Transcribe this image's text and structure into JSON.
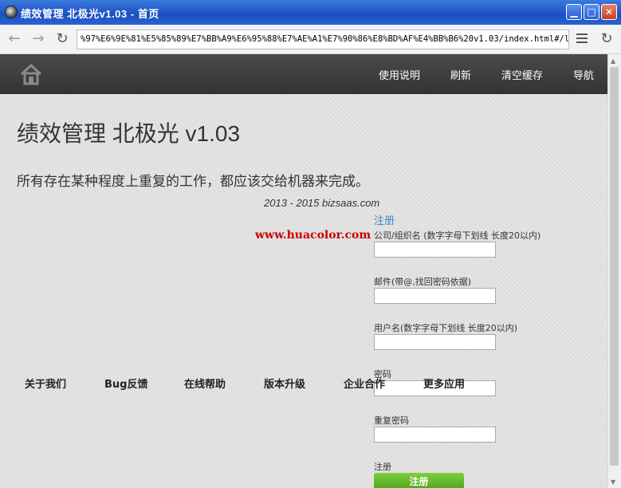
{
  "window": {
    "title": "绩效管理 北极光v1.03 - 首页",
    "minimize": "▁",
    "maximize": "□",
    "close": "✕"
  },
  "browser": {
    "back": "←",
    "forward": "→",
    "reload": "↻",
    "url": "%97%E6%9E%81%E5%85%89%E7%BB%A9%E6%95%88%E7%AE%A1%E7%90%86%E8%BD%AF%E4%BB%B6%20v1.03/index.html#/login"
  },
  "site_nav": {
    "home_icon": "home-icon",
    "links": [
      "使用说明",
      "刷新",
      "清空缓存",
      "导航"
    ]
  },
  "hero": {
    "title": "绩效管理 北极光 v1.03",
    "subtitle": "所有存在某种程度上重复的工作，都应该交给机器来完成。",
    "copyright": "2013 - 2015 bizsaas.com"
  },
  "watermark": "www.huacolor.com",
  "register": {
    "heading_link": "注册",
    "fields": [
      {
        "label": "公司/组织名 (数字字母下划线 长度20以内)",
        "value": ""
      },
      {
        "label": "邮件(带@,找回密码依据)",
        "value": ""
      },
      {
        "label": "用户名(数字字母下划线 长度20以内)",
        "value": ""
      },
      {
        "label": "密码",
        "value": ""
      },
      {
        "label": "重复密码",
        "value": ""
      }
    ],
    "submit_caption": "注册",
    "submit_button": "注册"
  },
  "footer": {
    "links": [
      "关于我们",
      "Bug反馈",
      "在线帮助",
      "版本升级",
      "企业合作",
      "更多应用"
    ]
  },
  "colors": {
    "nav_bg": "#3a3a3a",
    "link_blue": "#3a87c8",
    "watermark_red": "#cc0000",
    "button_green": "#5fb329"
  }
}
